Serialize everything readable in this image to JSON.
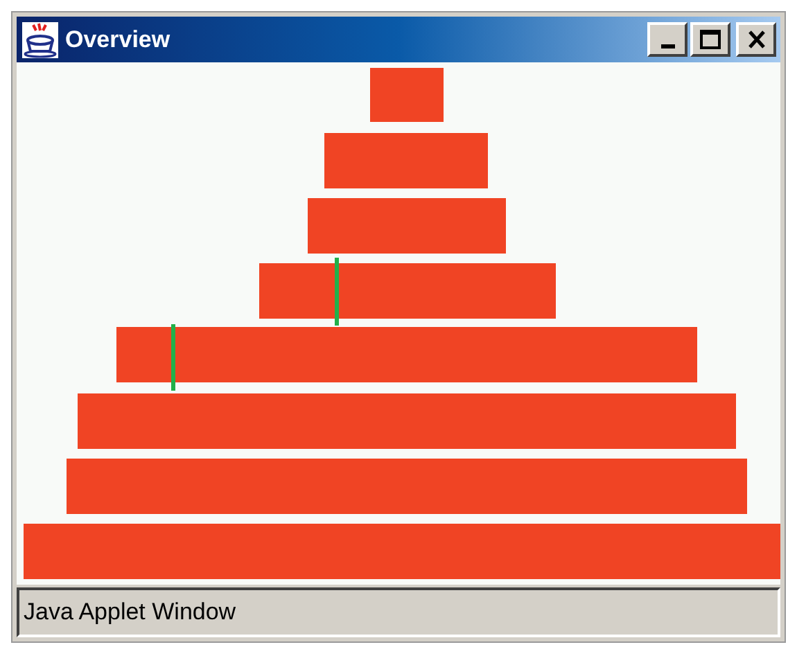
{
  "window": {
    "title": "Overview"
  },
  "status_bar": {
    "text": "Java Applet Window"
  }
}
